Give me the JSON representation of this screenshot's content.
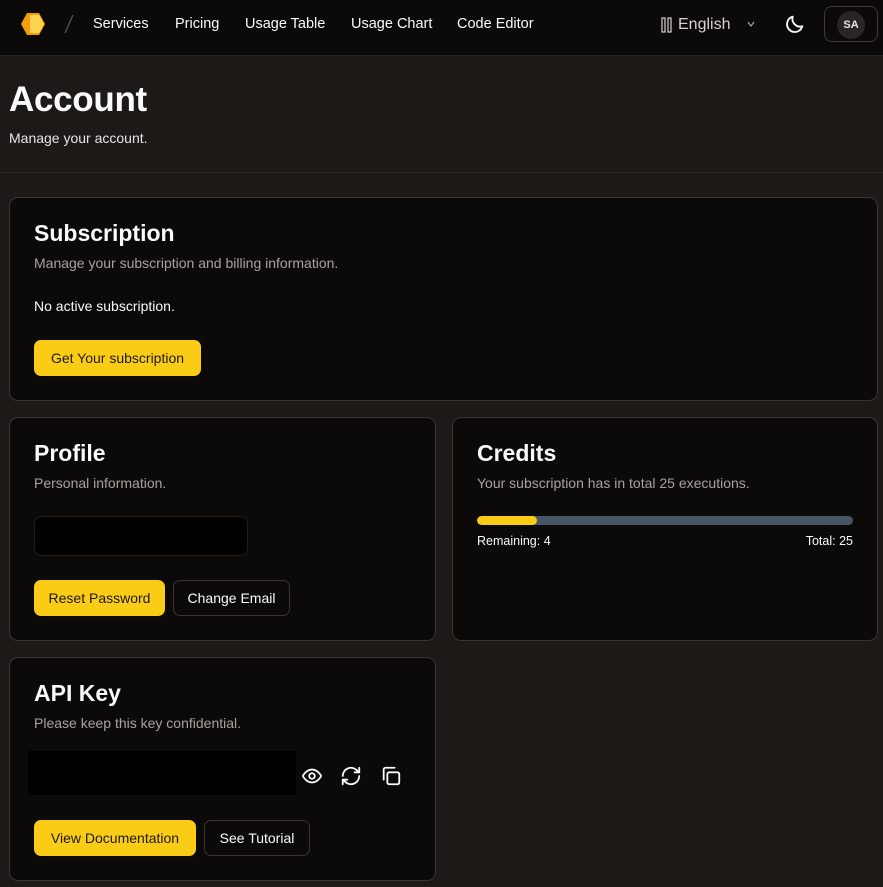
{
  "nav": {
    "links": [
      "Services",
      "Pricing",
      "Usage Table",
      "Usage Chart",
      "Code Editor"
    ],
    "language": "English",
    "user_initials": "SA"
  },
  "header": {
    "title": "Account",
    "subtitle": "Manage your account."
  },
  "subscription": {
    "title": "Subscription",
    "description": "Manage your subscription and billing information.",
    "status": "No active subscription.",
    "cta_label": "Get Your subscription"
  },
  "profile": {
    "title": "Profile",
    "description": "Personal information.",
    "reset_password_label": "Reset Password",
    "change_email_label": "Change Email"
  },
  "credits": {
    "title": "Credits",
    "description": "Your subscription has in total 25 executions.",
    "remaining_label": "Remaining: 4",
    "total_label": "Total: 25",
    "remaining": 4,
    "total": 25
  },
  "api_key": {
    "title": "API Key",
    "description": "Please keep this key confidential.",
    "view_docs_label": "View Documentation",
    "tutorial_label": "See Tutorial"
  },
  "colors": {
    "accent": "#facc15",
    "background": "#1c1917",
    "card": "#0c0a09",
    "track": "#475569"
  },
  "icons": [
    "hexagon-logo-icon",
    "language-icon",
    "chevron-down-icon",
    "moon-icon",
    "eye-icon",
    "refresh-icon",
    "copy-icon"
  ]
}
